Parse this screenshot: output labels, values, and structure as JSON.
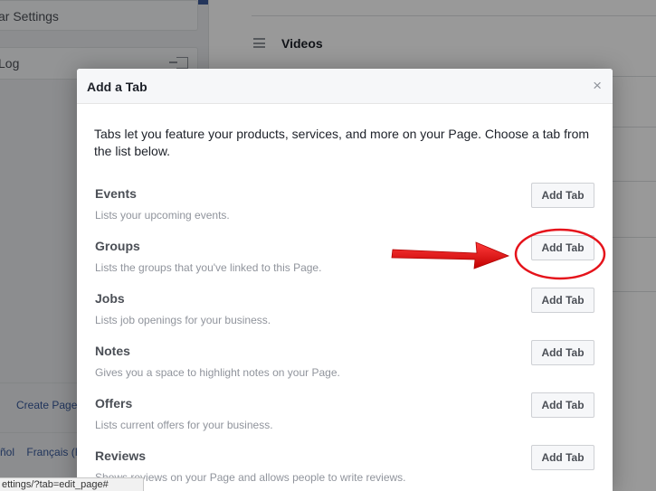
{
  "background": {
    "sidebar": {
      "settings_label": "ar Settings",
      "log_label": "Log"
    },
    "main": {
      "videos_label": "Videos"
    },
    "footer": {
      "create_page_label": "Create Page",
      "lang_1": "ñol",
      "lang_2": "Français (Fr"
    }
  },
  "status_bar": {
    "url": "ettings/?tab=edit_page#"
  },
  "dialog": {
    "title": "Add a Tab",
    "close_glyph": "×",
    "intro": "Tabs let you feature your products, services, and more on your Page. Choose a tab from the list below.",
    "button_label": "Add Tab",
    "tabs": [
      {
        "name": "Events",
        "description": "Lists your upcoming events."
      },
      {
        "name": "Groups",
        "description": "Lists the groups that you've linked to this Page."
      },
      {
        "name": "Jobs",
        "description": "Lists job openings for your business."
      },
      {
        "name": "Notes",
        "description": "Gives you a space to highlight notes on your Page."
      },
      {
        "name": "Offers",
        "description": "Lists current offers for your business."
      },
      {
        "name": "Reviews",
        "description": "Shows reviews on your Page and allows people to write reviews."
      }
    ]
  },
  "annotation": {
    "highlighted_tab": "Groups",
    "color": "#e5131b"
  },
  "colors": {
    "brand": "#3b5998",
    "link": "#365899",
    "overlay": "rgba(0,0,0,0.4)"
  },
  "icons": {
    "close": "close-icon",
    "logout": "logout-icon",
    "menu": "hamburger-icon"
  }
}
